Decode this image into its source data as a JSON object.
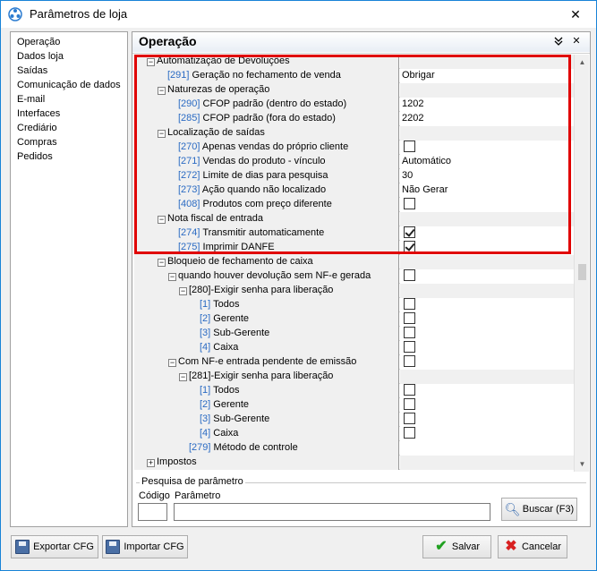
{
  "window": {
    "title": "Parâmetros de loja",
    "minimize_glyph": "—",
    "maximize_glyph": "☐",
    "close_glyph": "✕",
    "icon": "app-icon"
  },
  "sidebar": {
    "items": [
      {
        "label": "Operação"
      },
      {
        "label": "Dados loja"
      },
      {
        "label": "Saídas"
      },
      {
        "label": "Comunicação de dados"
      },
      {
        "label": "E-mail"
      },
      {
        "label": "Interfaces"
      },
      {
        "label": "Crediário"
      },
      {
        "label": "Compras"
      },
      {
        "label": "Pedidos"
      }
    ]
  },
  "main": {
    "title": "Operação",
    "collapse_glyph": "⌄⌄",
    "close_glyph": "✕"
  },
  "grid": {
    "rows": [
      {
        "indent": 0,
        "expander": "−",
        "code": "",
        "label": "Automatização de Devoluções",
        "value": "",
        "type": "group"
      },
      {
        "indent": 1,
        "expander": "",
        "code": "[291]",
        "label": " Geração no fechamento de venda",
        "value": "Obrigar",
        "type": "text"
      },
      {
        "indent": 1,
        "expander": "−",
        "code": "",
        "label": "Naturezas de operação",
        "value": "",
        "type": "group"
      },
      {
        "indent": 2,
        "expander": "",
        "code": "[290]",
        "label": " CFOP padrão (dentro do estado)",
        "value": "1202",
        "type": "text"
      },
      {
        "indent": 2,
        "expander": "",
        "code": "[285]",
        "label": " CFOP padrão (fora do estado)",
        "value": "2202",
        "type": "text"
      },
      {
        "indent": 1,
        "expander": "−",
        "code": "",
        "label": "Localização de saídas",
        "value": "",
        "type": "group"
      },
      {
        "indent": 2,
        "expander": "",
        "code": "[270]",
        "label": " Apenas vendas do próprio cliente",
        "value": "",
        "type": "check",
        "checked": false
      },
      {
        "indent": 2,
        "expander": "",
        "code": "[271]",
        "label": " Vendas do produto - vínculo",
        "value": "Automático",
        "type": "text"
      },
      {
        "indent": 2,
        "expander": "",
        "code": "[272]",
        "label": " Limite de dias para pesquisa",
        "value": "30",
        "type": "text"
      },
      {
        "indent": 2,
        "expander": "",
        "code": "[273]",
        "label": " Ação quando não localizado",
        "value": "Não Gerar",
        "type": "text"
      },
      {
        "indent": 2,
        "expander": "",
        "code": "[408]",
        "label": " Produtos com preço diferente",
        "value": "",
        "type": "check",
        "checked": false
      },
      {
        "indent": 1,
        "expander": "−",
        "code": "",
        "label": "Nota fiscal de entrada",
        "value": "",
        "type": "group"
      },
      {
        "indent": 2,
        "expander": "",
        "code": "[274]",
        "label": " Transmitir automaticamente",
        "value": "",
        "type": "check",
        "checked": true
      },
      {
        "indent": 2,
        "expander": "",
        "code": "[275]",
        "label": " Imprimir DANFE",
        "value": "",
        "type": "check",
        "checked": true
      },
      {
        "indent": 1,
        "expander": "−",
        "code": "",
        "label": "Bloqueio de fechamento de caixa",
        "value": "",
        "type": "group"
      },
      {
        "indent": 2,
        "expander": "−",
        "code": "",
        "label": "quando houver devolução sem NF-e gerada",
        "value": "",
        "type": "check",
        "checked": false
      },
      {
        "indent": 3,
        "expander": "−",
        "code": "",
        "label": "[280]-Exigir senha para liberação",
        "value": "",
        "type": "group"
      },
      {
        "indent": 4,
        "expander": "",
        "code": "[1]",
        "label": " Todos",
        "value": "",
        "type": "check",
        "checked": false
      },
      {
        "indent": 4,
        "expander": "",
        "code": "[2]",
        "label": " Gerente",
        "value": "",
        "type": "check",
        "checked": false
      },
      {
        "indent": 4,
        "expander": "",
        "code": "[3]",
        "label": " Sub-Gerente",
        "value": "",
        "type": "check",
        "checked": false
      },
      {
        "indent": 4,
        "expander": "",
        "code": "[4]",
        "label": " Caixa",
        "value": "",
        "type": "check",
        "checked": false
      },
      {
        "indent": 2,
        "expander": "−",
        "code": "",
        "label": "Com NF-e entrada pendente de emissão",
        "value": "",
        "type": "check",
        "checked": false
      },
      {
        "indent": 3,
        "expander": "−",
        "code": "",
        "label": "[281]-Exigir senha para liberação",
        "value": "",
        "type": "group"
      },
      {
        "indent": 4,
        "expander": "",
        "code": "[1]",
        "label": " Todos",
        "value": "",
        "type": "check",
        "checked": false
      },
      {
        "indent": 4,
        "expander": "",
        "code": "[2]",
        "label": " Gerente",
        "value": "",
        "type": "check",
        "checked": false
      },
      {
        "indent": 4,
        "expander": "",
        "code": "[3]",
        "label": " Sub-Gerente",
        "value": "",
        "type": "check",
        "checked": false
      },
      {
        "indent": 4,
        "expander": "",
        "code": "[4]",
        "label": " Caixa",
        "value": "",
        "type": "check",
        "checked": false
      },
      {
        "indent": 3,
        "expander": "",
        "code": "[279]",
        "label": " Método de controle",
        "value": "",
        "type": "text"
      },
      {
        "indent": 0,
        "expander": "+",
        "code": "",
        "label": "Impostos",
        "value": "",
        "type": "group"
      }
    ]
  },
  "search": {
    "legend": "Pesquisa de parâmetro",
    "codigo_label": "Código",
    "parametro_label": "Parâmetro",
    "codigo_value": "",
    "parametro_value": "",
    "buscar_label": "Buscar (F3)"
  },
  "footer": {
    "export_label": "Exportar CFG",
    "import_label": "Importar CFG",
    "salvar_label": "Salvar",
    "cancelar_label": "Cancelar"
  }
}
